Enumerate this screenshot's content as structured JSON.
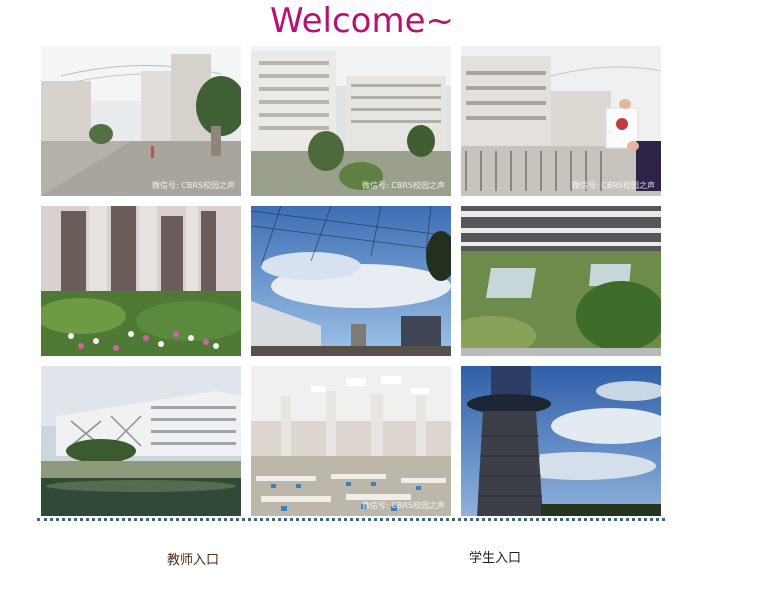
{
  "header": {
    "title": "Welcome~"
  },
  "gallery": {
    "photos": [
      {
        "subject": "campus plaza with teaching buildings and canopy",
        "watermark": "微信号: CBRS校园之声"
      },
      {
        "subject": "white teaching buildings with courtyard garden",
        "watermark": "微信号: CBRS校园之声"
      },
      {
        "subject": "campus gate with hand holding a card",
        "watermark": "微信号: CBRS校园之声"
      },
      {
        "subject": "building facade with flower garden",
        "watermark": ""
      },
      {
        "subject": "blue sky through steel lattice canopy",
        "watermark": ""
      },
      {
        "subject": "rooftop garden with skylights",
        "watermark": ""
      },
      {
        "subject": "building by a pond",
        "watermark": ""
      },
      {
        "subject": "canteen hall with tables and stools",
        "watermark": "微信号: CBRS校园之声"
      },
      {
        "subject": "round tower against blue sky",
        "watermark": ""
      }
    ]
  },
  "entries": {
    "teacher_label": "教师入口",
    "student_label": "学生入口"
  },
  "colors": {
    "title": "#b51273",
    "divider": "#3f6577",
    "teacher_link": "#4a2a17",
    "student_link": "#1d1d1d"
  }
}
